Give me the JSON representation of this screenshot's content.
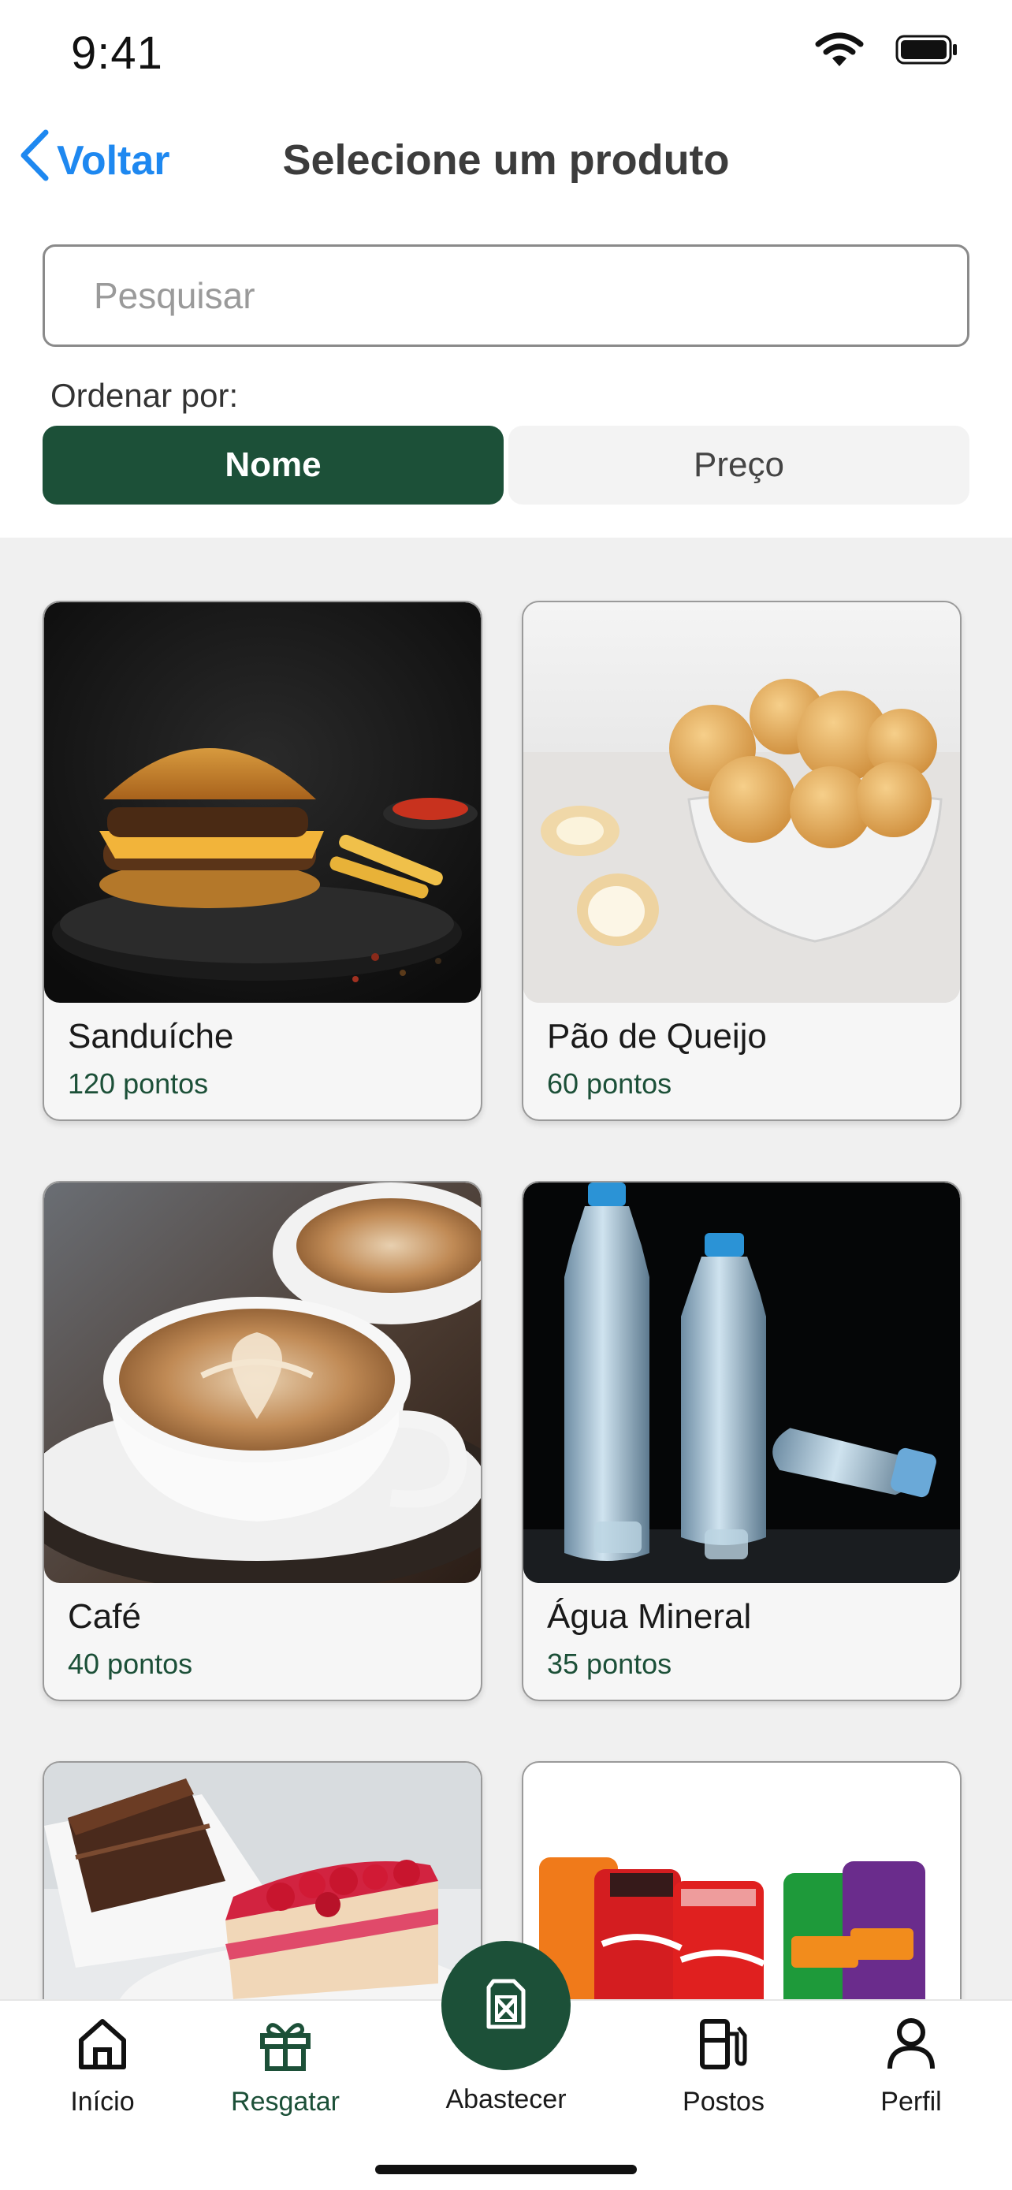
{
  "status_bar": {
    "time": "9:41"
  },
  "header": {
    "back_label": "Voltar",
    "title": "Selecione um produto"
  },
  "search": {
    "placeholder": "Pesquisar",
    "value": ""
  },
  "sort": {
    "label": "Ordenar por:",
    "options": [
      "Nome",
      "Preço"
    ],
    "selected": "Nome"
  },
  "products": [
    {
      "name": "Sanduíche",
      "points": "120 pontos",
      "image": "burger-photo"
    },
    {
      "name": "Pão de Queijo",
      "points": "60 pontos",
      "image": "cheese-bread-photo"
    },
    {
      "name": "Café",
      "points": "40 pontos",
      "image": "coffee-photo"
    },
    {
      "name": "Água Mineral",
      "points": "35 pontos",
      "image": "water-bottles-photo"
    },
    {
      "name": "",
      "points": "",
      "image": "cake-photo"
    },
    {
      "name": "",
      "points": "",
      "image": "soda-cans-photo"
    }
  ],
  "tabbar": {
    "items": [
      {
        "label": "Início",
        "icon": "home-icon"
      },
      {
        "label": "Resgatar",
        "icon": "gift-icon"
      },
      {
        "label": "Abastecer",
        "icon": "fuel-can-icon"
      },
      {
        "label": "Postos",
        "icon": "gas-station-icon"
      },
      {
        "label": "Perfil",
        "icon": "user-icon"
      }
    ],
    "active": "Resgatar"
  },
  "colors": {
    "primary": "#1c5038",
    "link": "#1e88f0",
    "background": "#f0f0f0"
  }
}
